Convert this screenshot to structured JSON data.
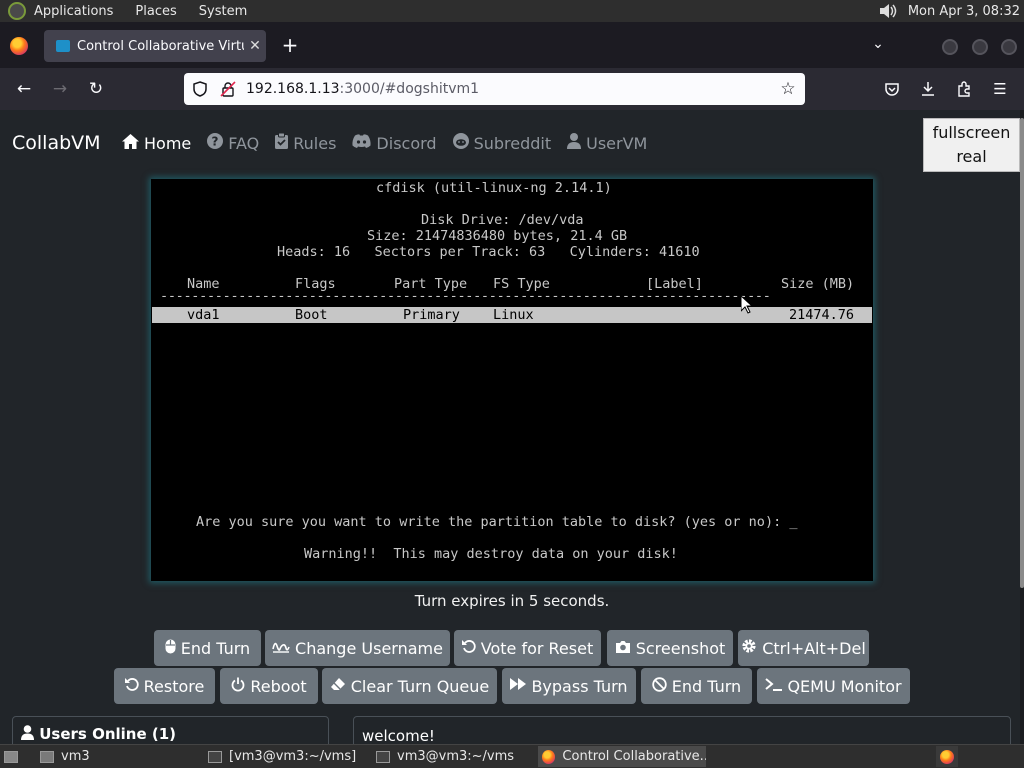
{
  "top_panel": {
    "menus": [
      "Applications",
      "Places",
      "System"
    ],
    "clock": "Mon Apr  3, 08:32"
  },
  "browser": {
    "tab_title": "Control Collaborative Virtual",
    "url_host": "192.168.1.13",
    "url_rest": ":3000/#dogshitvm1"
  },
  "site": {
    "brand": "CollabVM",
    "nav": [
      {
        "label": "Home",
        "icon": "home-icon"
      },
      {
        "label": "FAQ",
        "icon": "question-icon"
      },
      {
        "label": "Rules",
        "icon": "clipboard-check-icon"
      },
      {
        "label": "Discord",
        "icon": "discord-icon"
      },
      {
        "label": "Subreddit",
        "icon": "reddit-icon"
      },
      {
        "label": "UserVM",
        "icon": "user-icon"
      }
    ],
    "fullscreen_line1": "fullscreen",
    "fullscreen_line2": "real"
  },
  "vm": {
    "title": "cfdisk (util-linux-ng 2.14.1)",
    "disk_drive": "Disk Drive: /dev/vda",
    "size_line": "Size: 21474836480 bytes, 21.4 GB",
    "geometry_line": "Heads: 16   Sectors per Track: 63   Cylinders: 41610",
    "columns": {
      "name": "Name",
      "flags": "Flags",
      "part_type": "Part Type",
      "fs_type": "FS Type",
      "label": "[Label]",
      "size": "Size (MB)"
    },
    "separator": "------------------------------------------------------------------------------",
    "row": {
      "name": "vda1",
      "flags": "Boot",
      "part_type": "Primary",
      "fs_type": "Linux",
      "size": "21474.76"
    },
    "prompt": "Are you sure you want to write the partition table to disk? (yes or no): _",
    "warning": "Warning!!  This may destroy data on your disk!"
  },
  "turn_text": "Turn expires in 5 seconds.",
  "buttons_row1": [
    {
      "label": "End Turn",
      "icon": "mouse-icon"
    },
    {
      "label": "Change Username",
      "icon": "signature-icon"
    },
    {
      "label": "Vote for Reset",
      "icon": "rotate-left-icon"
    },
    {
      "label": "Screenshot",
      "icon": "camera-icon"
    },
    {
      "label": "Ctrl+Alt+Del",
      "icon": "gear-icon"
    }
  ],
  "buttons_row2": [
    {
      "label": "Restore",
      "icon": "rotate-left-icon"
    },
    {
      "label": "Reboot",
      "icon": "power-icon"
    },
    {
      "label": "Clear Turn Queue",
      "icon": "eraser-icon"
    },
    {
      "label": "Bypass Turn",
      "icon": "forward-icon"
    },
    {
      "label": "End Turn",
      "icon": "ban-icon"
    },
    {
      "label": "QEMU Monitor",
      "icon": "terminal-icon"
    }
  ],
  "users_online": "Users Online (1)",
  "chat_first_line": "welcome!",
  "taskbar": {
    "items": [
      "vm3",
      "[vm3@vm3:~/vms]",
      "vm3@vm3:~/vms",
      "Control Collaborative..."
    ]
  }
}
